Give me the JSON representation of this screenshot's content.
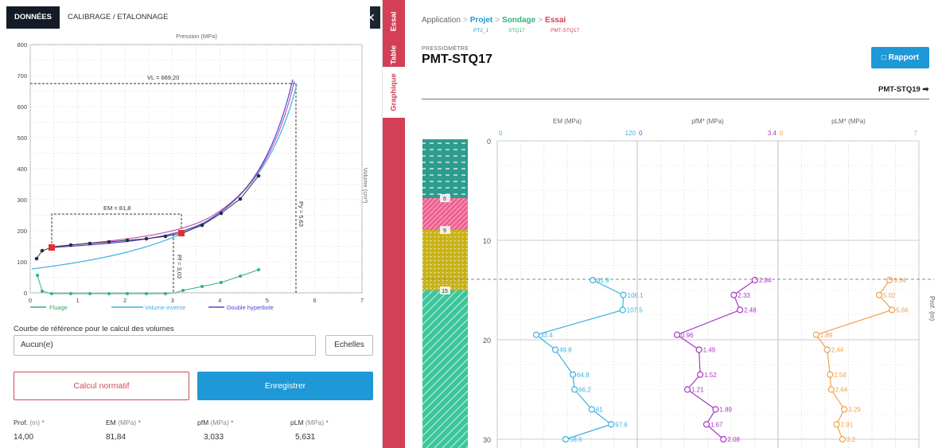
{
  "left_tabs": {
    "active": "DONNÉES",
    "other": "CALIBRAGE / ETALONNAGE",
    "close": "✕"
  },
  "pressure_chart": {
    "top_label": "Pression (MPa)",
    "right_label": "Volume (cm³)",
    "y_ticks": [
      "800",
      "700",
      "600",
      "500",
      "400",
      "300",
      "200",
      "100",
      "0"
    ],
    "x_ticks": [
      "0",
      "1",
      "2",
      "3",
      "4",
      "5",
      "6",
      "7"
    ],
    "vl_label": "VL = 669,20",
    "em_label": "EM = 81,8",
    "pf_label": "Pf = 3,03",
    "py_label": "Py = 5,63",
    "legend": [
      {
        "name": "Fluage",
        "color": "#31b37a"
      },
      {
        "name": "Volume inverse",
        "color": "#3bb3e0"
      },
      {
        "name": "Double hyperbole",
        "color": "#4a4ad8"
      }
    ]
  },
  "ref": {
    "label": "Courbe de référence pour le calcul des volumes",
    "value": "Aucun(e)",
    "scales_button": "Echelles"
  },
  "actions": {
    "calc": "Calcul normatif",
    "save": "Enregistrer"
  },
  "fields": [
    {
      "label": "Prof.",
      "unit": "(m)",
      "value": "14,00"
    },
    {
      "label": "EM",
      "unit": "(MPa)",
      "value": "81,84"
    },
    {
      "label": "pfM",
      "unit": "(MPa)",
      "value": "3,033"
    },
    {
      "label": "pLM",
      "unit": "(MPa)",
      "value": "5,631"
    }
  ],
  "side_tabs": [
    "Essai",
    "Table",
    "Graphique"
  ],
  "breadcrumb": {
    "items": [
      "Application",
      "Projet",
      "Sondage",
      "Essai"
    ],
    "subs": [
      "PT2_1",
      "STQ17",
      "PMT-STQ17"
    ]
  },
  "header": {
    "kicker": "PRESSIOMÈTRE",
    "title": "PMT-STQ17",
    "report_button": "Rapport",
    "next": "PMT-STQ19"
  },
  "log": {
    "depth_ticks": [
      "0",
      "10",
      "20",
      "30"
    ],
    "layers": [
      "6",
      "9",
      "15"
    ],
    "depth_label": "Prof. (m)",
    "tracks": [
      {
        "title": "EM (MPa)",
        "min": "0",
        "max": "120",
        "color": "#3bb3e0",
        "depths": [
          14,
          15.5,
          17,
          19.5,
          21,
          23.5,
          25,
          27,
          28.5,
          30
        ],
        "values": [
          81.9,
          108.1,
          107.5,
          33.4,
          49.8,
          64.8,
          66.2,
          81,
          97.6,
          58.6
        ],
        "labels": [
          "81.9",
          "108.1",
          "107.5",
          "33.4",
          "49.8",
          "64.8",
          "66.2",
          "81",
          "97.6",
          "58.6"
        ]
      },
      {
        "title": "pfM* (MPa)",
        "min": "0",
        "max": "3.4",
        "color": "#a838c4",
        "depths": [
          14,
          15.5,
          17,
          19.5,
          21,
          23.5,
          25,
          27,
          28.5,
          30
        ],
        "values": [
          2.84,
          2.33,
          2.48,
          0.96,
          1.49,
          1.52,
          1.21,
          1.89,
          1.67,
          2.08
        ],
        "labels": [
          "2.84",
          "2.33",
          "2.48",
          "0.96",
          "1.49",
          "1.52",
          "1.21",
          "1.89",
          "1.67",
          "2.08"
        ]
      },
      {
        "title": "pLM* (MPa)",
        "min": "0",
        "max": "7",
        "color": "#f0a04b",
        "depths": [
          14,
          15.5,
          17,
          19.5,
          21,
          23.5,
          25,
          27,
          28.5,
          30
        ],
        "values": [
          5.54,
          5.02,
          5.66,
          1.89,
          2.44,
          2.58,
          2.64,
          3.29,
          2.91,
          3.2
        ],
        "labels": [
          "5.54",
          "5.02",
          "5.66",
          "1.89",
          "2.44",
          "2.58",
          "2.64",
          "3.29",
          "2.91",
          "3.2"
        ]
      }
    ]
  }
}
